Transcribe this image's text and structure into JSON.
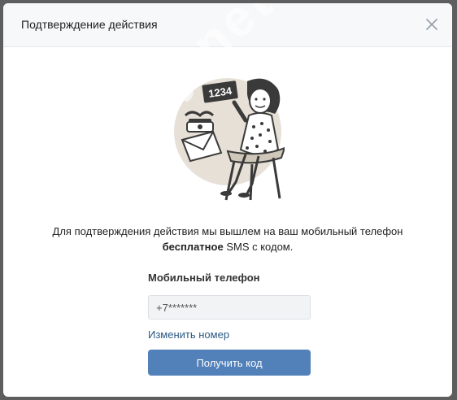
{
  "dialog": {
    "title": "Подтверждение действия",
    "close_icon": "close-icon"
  },
  "illustration": {
    "sign_text": "1234"
  },
  "message": {
    "line1": "Для подтверждения действия мы вышлем на ваш мобильный телефон",
    "bold": "бесплатное",
    "line2_rest": " SMS с кодом."
  },
  "phone_field": {
    "label": "Мобильный телефон",
    "value": "+7*******"
  },
  "change_link": "Изменить номер",
  "submit_button": "Получить код",
  "watermark": "codeby.net",
  "colors": {
    "accent": "#5181b8",
    "link": "#2a5885",
    "header_bg": "#f7f8fa"
  }
}
